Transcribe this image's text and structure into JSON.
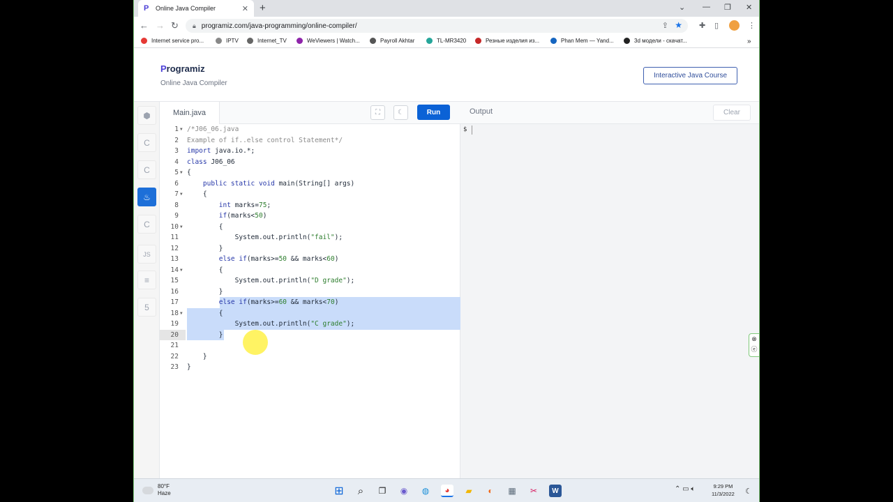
{
  "browser": {
    "tab_title": "Online Java Compiler",
    "tab_close": "✕",
    "new_tab": "+",
    "url": "programiz.com/java-programming/online-compiler/"
  },
  "bookmarks": [
    {
      "label": "Internet service pro...",
      "color": "#e53935"
    },
    {
      "label": "IPTV",
      "color": "#888888"
    },
    {
      "label": "Internet_TV",
      "color": "#666666"
    },
    {
      "label": "WeViewers | Watch...",
      "color": "#8e24aa"
    },
    {
      "label": "Payroll Akhtar",
      "color": "#555555"
    },
    {
      "label": "TL-MR3420",
      "color": "#26a69a"
    },
    {
      "label": "Резные изделия из...",
      "color": "#c62828"
    },
    {
      "label": "Phan Mem — Yand...",
      "color": "#1565c0"
    },
    {
      "label": "3d модели - скачат...",
      "color": "#222222"
    }
  ],
  "site": {
    "logo_p": "P",
    "logo_rest": "rogramiz",
    "subtitle": "Online Java Compiler",
    "course_button": "Interactive Java Course"
  },
  "sidebar": {
    "items": [
      {
        "name": "python",
        "glyph": "⬢"
      },
      {
        "name": "c",
        "glyph": "C"
      },
      {
        "name": "cpp",
        "glyph": "C"
      },
      {
        "name": "java",
        "glyph": "♨"
      },
      {
        "name": "csharp",
        "glyph": "C"
      },
      {
        "name": "javascript",
        "glyph": "JS"
      },
      {
        "name": "sql",
        "glyph": "≡"
      },
      {
        "name": "html",
        "glyph": "5"
      }
    ],
    "active": "java"
  },
  "editor": {
    "file_tab": "Main.java",
    "run_label": "Run",
    "active_line": 20,
    "lines": [
      {
        "n": "1",
        "fold": true,
        "html": "<span class=\"cm\">/*J06_06.java</span>"
      },
      {
        "n": "2",
        "fold": false,
        "html": "<span class=\"cm\">Example of if..else control Statement*/</span>"
      },
      {
        "n": "3",
        "fold": false,
        "html": "<span class=\"kw\">import</span> java.io.*;"
      },
      {
        "n": "4",
        "fold": false,
        "html": "<span class=\"kw\">class</span> J06_06"
      },
      {
        "n": "5",
        "fold": true,
        "html": "{"
      },
      {
        "n": "6",
        "fold": false,
        "html": "    <span class=\"kw\">public static void</span> main(String[] args)"
      },
      {
        "n": "7",
        "fold": true,
        "html": "    {"
      },
      {
        "n": "8",
        "fold": false,
        "html": "        <span class=\"kw\">int</span> marks=<span class=\"num\">75</span>;"
      },
      {
        "n": "9",
        "fold": false,
        "html": "        <span class=\"kw\">if</span>(marks&lt;<span class=\"num\">50</span>)"
      },
      {
        "n": "10",
        "fold": true,
        "html": "        {"
      },
      {
        "n": "11",
        "fold": false,
        "html": "            System.out.println(<span class=\"str\">\"fail\"</span>);"
      },
      {
        "n": "12",
        "fold": false,
        "html": "        }"
      },
      {
        "n": "13",
        "fold": false,
        "html": "        <span class=\"kw\">else if</span>(marks&gt;=<span class=\"num\">50</span> &amp;&amp; marks&lt;<span class=\"num\">60</span>)"
      },
      {
        "n": "14",
        "fold": true,
        "html": "        {"
      },
      {
        "n": "15",
        "fold": false,
        "html": "            System.out.println(<span class=\"str\">\"D grade\"</span>);"
      },
      {
        "n": "16",
        "fold": false,
        "html": "        }"
      },
      {
        "n": "17",
        "fold": false,
        "html": "        <span class=\"kw\">else if</span>(marks&gt;=<span class=\"num\">60</span> &amp;&amp; marks&lt;<span class=\"num\">70</span>)"
      },
      {
        "n": "18",
        "fold": true,
        "html": "        {"
      },
      {
        "n": "19",
        "fold": false,
        "html": "            System.out.println(<span class=\"str\">\"C grade\"</span>);"
      },
      {
        "n": "20",
        "fold": false,
        "html": "        }"
      },
      {
        "n": "21",
        "fold": false,
        "html": ""
      },
      {
        "n": "22",
        "fold": false,
        "html": "    }"
      },
      {
        "n": "23",
        "fold": false,
        "html": "}"
      }
    ],
    "selection": {
      "from_line": 17,
      "to_line": 20
    }
  },
  "output": {
    "title": "Output",
    "clear_label": "Clear",
    "prompt": "$"
  },
  "taskbar": {
    "temperature": "80°F",
    "weather": "Haze",
    "time": "9:29 PM",
    "date": "11/3/2022"
  }
}
